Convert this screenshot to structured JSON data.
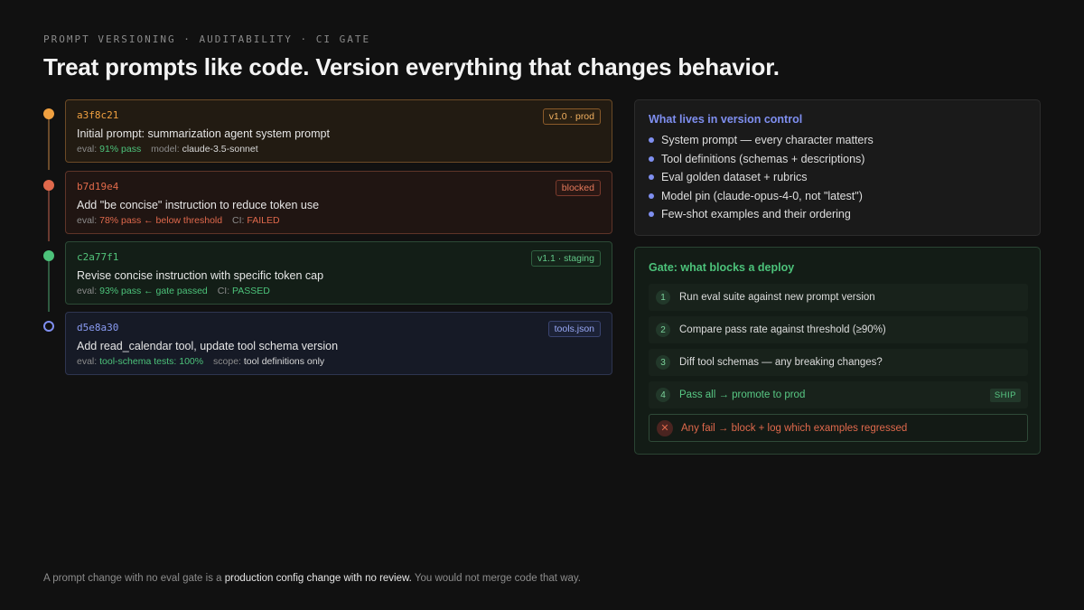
{
  "eyebrow": "PROMPT VERSIONING · AUDITABILITY · CI GATE",
  "title": "Treat prompts like code. Version everything that changes behavior.",
  "commits": [
    {
      "hash": "a3f8c21",
      "badge": "v1.0 · prod",
      "message": "Initial prompt: summarization agent system prompt",
      "meta_a_label": "eval:",
      "meta_a_value": "91% pass",
      "meta_b_label": "model:",
      "meta_b_value": "claude-3.5-sonnet",
      "dot_color": "#f0a040"
    },
    {
      "hash": "b7d19e4",
      "badge": "blocked",
      "message": "Add \"be concise\" instruction to reduce token use",
      "meta_a_label": "eval:",
      "meta_a_value": "78% pass ← below threshold",
      "meta_b_label": "CI:",
      "meta_b_value": "FAILED",
      "dot_color": "#e0694c"
    },
    {
      "hash": "c2a77f1",
      "badge": "v1.1 · staging",
      "message": "Revise concise instruction with specific token cap",
      "meta_a_label": "eval:",
      "meta_a_value": "93% pass ← gate passed",
      "meta_b_label": "CI:",
      "meta_b_value": "PASSED",
      "dot_color": "#4cc27a"
    },
    {
      "hash": "d5e8a30",
      "badge": "tools.json",
      "message": "Add read_calendar tool, update tool schema version",
      "meta_a_label": "eval:",
      "meta_a_value": "tool-schema tests: 100%",
      "meta_b_label": "scope:",
      "meta_b_value": "tool definitions only",
      "dot_color": "#7f8ff0"
    }
  ],
  "version_control": {
    "heading": "What lives in version control",
    "items": [
      "System prompt — every character matters",
      "Tool definitions (schemas + descriptions)",
      "Eval golden dataset + rubrics",
      "Model pin (claude-opus-4-0, not \"latest\")",
      "Few-shot examples and their ordering"
    ]
  },
  "gate": {
    "heading": "Gate: what blocks a deploy",
    "steps": [
      {
        "num": "1",
        "text": "Run eval suite against new prompt version"
      },
      {
        "num": "2",
        "text": "Compare pass rate against threshold (≥90%)"
      },
      {
        "num": "3",
        "text": "Diff tool schemas — any breaking changes?"
      },
      {
        "num": "4",
        "text": "Pass all → promote to prod",
        "tag": "SHIP"
      }
    ],
    "fail_icon": "✕",
    "fail_text": "Any fail → block + log which examples regressed"
  },
  "footer": {
    "pre": "A prompt change with no eval gate is a ",
    "bold": "production config change with no review.",
    "post": " You would not merge code that way."
  }
}
